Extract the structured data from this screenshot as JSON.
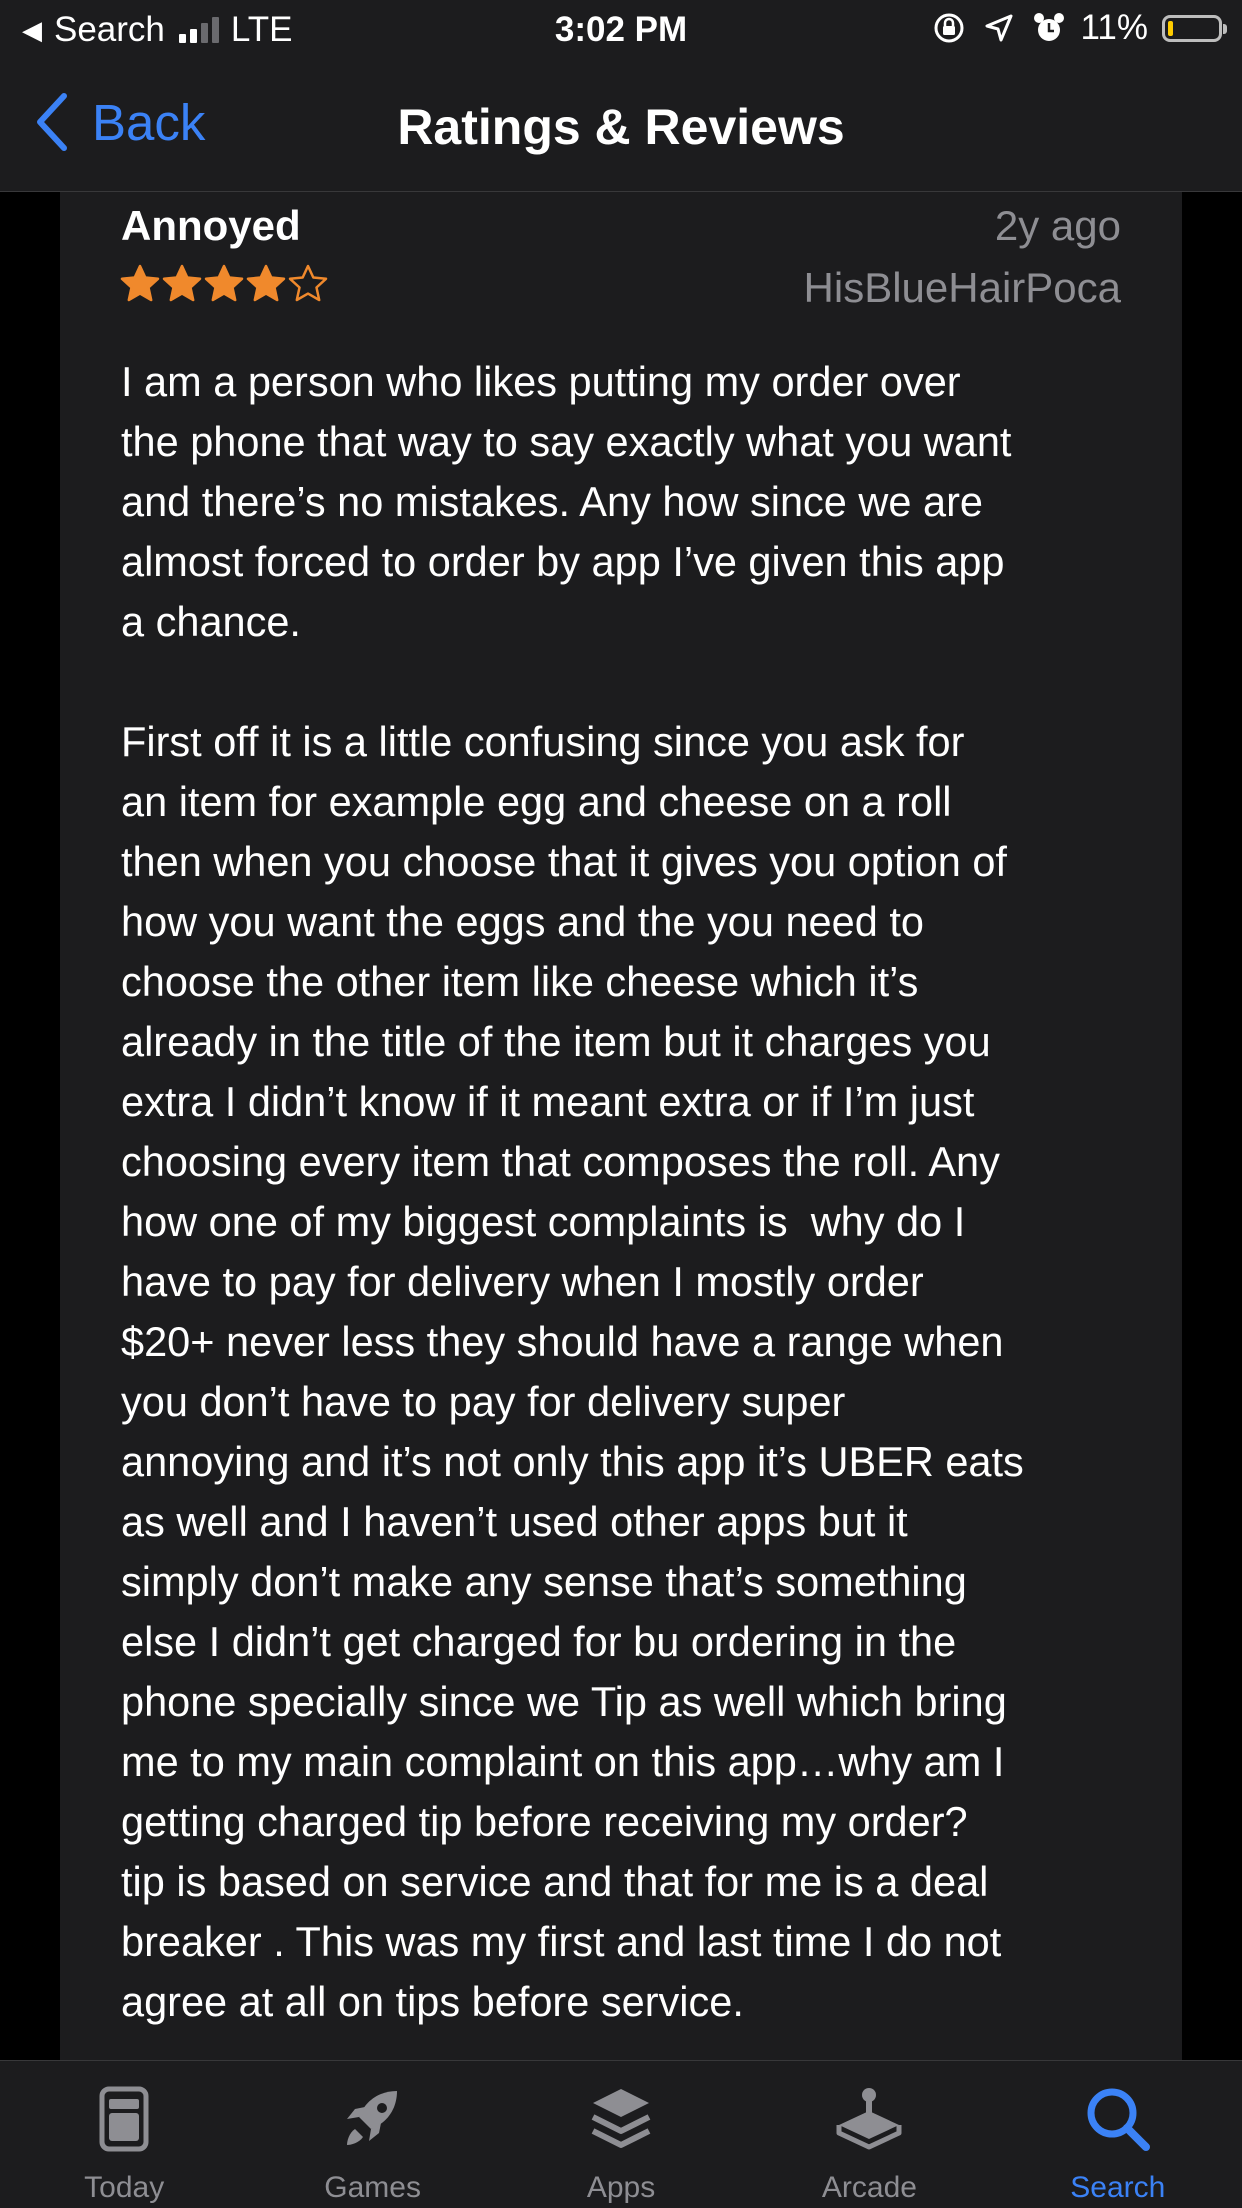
{
  "status_bar": {
    "back_app": "Search",
    "network": "LTE",
    "time": "3:02 PM",
    "battery_percent_text": "11%",
    "battery_level": 0.11,
    "icons": [
      "signal-icon",
      "orientation-lock-icon",
      "location-icon",
      "alarm-icon",
      "battery-icon"
    ]
  },
  "nav": {
    "back_label": "Back",
    "title": "Ratings & Reviews"
  },
  "review": {
    "title": "Annoyed",
    "date": "2y ago",
    "author": "HisBlueHairPoca",
    "rating": 4,
    "max_rating": 5,
    "star_color": "#f0892c",
    "body": "I am a person who likes putting my order over\nthe phone that way to say exactly what you want\nand there’s no mistakes. Any how since we are\nalmost forced to order by app I’ve given this app\na chance.\n\nFirst off it is a little confusing since you ask for\nan item for example egg and cheese on a roll\nthen when you choose that it gives you option of\nhow you want the eggs and the you need to\nchoose the other item like cheese which it’s\nalready in the title of the item but it charges you\nextra I didn’t know if it meant extra or if I’m just\nchoosing every item that composes the roll. Any\nhow one of my biggest complaints is  why do I\nhave to pay for delivery when I mostly order\n$20+ never less they should have a range when\nyou don’t have to pay for delivery super\nannoying and it’s not only this app it’s UBER eats\nas well and I haven’t used other apps but it\nsimply don’t make any sense that’s something\nelse I didn’t get charged for bu ordering in the\nphone specially since we Tip as well which bring\nme to my main complaint on this app…why am I\ngetting charged tip before receiving my order?\ntip is based on service and that for me is a deal\nbreaker . This was my first and last time I do not\nagree at all on tips before service."
  },
  "tab_bar": {
    "tabs": [
      {
        "label": "Today",
        "icon": "today-icon",
        "active": false
      },
      {
        "label": "Games",
        "icon": "rocket-icon",
        "active": false
      },
      {
        "label": "Apps",
        "icon": "apps-stack-icon",
        "active": false
      },
      {
        "label": "Arcade",
        "icon": "joystick-icon",
        "active": false
      },
      {
        "label": "Search",
        "icon": "search-icon",
        "active": true
      }
    ],
    "active_color": "#3b82f6",
    "inactive_color": "#8e8e93"
  }
}
